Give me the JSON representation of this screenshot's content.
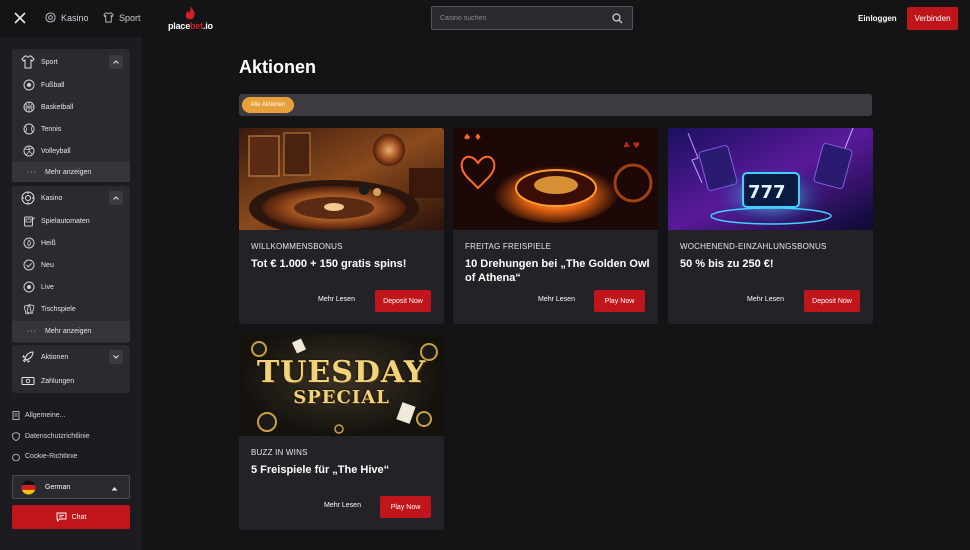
{
  "topbar": {
    "casino_label": "Kasino",
    "sport_label": "Sport",
    "logo_text_a": "place",
    "logo_text_b": "bet",
    "logo_text_c": ".io",
    "search_placeholder": "Casino suchen",
    "login_label": "Einloggen",
    "register_label": "Verbinden"
  },
  "sidebar": {
    "sport_head": "Sport",
    "sport_items": [
      "Fußball",
      "Basketball",
      "Tennis",
      "Volleyball"
    ],
    "sport_more": "Mehr anzeigen",
    "casino_head": "Kasino",
    "casino_items": [
      "Spielautomaten",
      "Heiß",
      "Neu",
      "Live",
      "Tischspiele"
    ],
    "casino_more": "Mehr anzeigen",
    "actions_label": "Aktionen",
    "payments_label": "Zahlungen",
    "links": [
      "Allgemeine...",
      "Datenschutzrichtlinie",
      "Cookie-Richtlinie"
    ],
    "language": "German",
    "chat": "Chat"
  },
  "main": {
    "title": "Aktionen",
    "filter_all": "Alle Aktionen"
  },
  "promos": [
    {
      "category": "WILLKOMMENSBONUS",
      "title": "Tot € 1.000 + 150 gratis spins!",
      "more": "Mehr Lesen",
      "cta": "Deposit Now"
    },
    {
      "category": "FREITAG FREISPIELE",
      "title": "10 Drehungen bei „The Golden Owl of Athena“",
      "more": "Mehr Lesen",
      "cta": "Play Now"
    },
    {
      "category": "WOCHENEND-EINZAHLUNGSBONUS",
      "title": "50 % bis zu 250 €!",
      "more": "Mehr Lesen",
      "cta": "Deposit Now"
    },
    {
      "category": "BUZZ IN WINS",
      "title": "5 Freispiele für „The Hive“",
      "more": "Mehr Lesen",
      "cta": "Play Now",
      "banner_line1": "TUESDAY",
      "banner_line2": "SPECIAL"
    }
  ],
  "colors": {
    "accent": "#c1151c",
    "pill": "#e8a13a",
    "bg": "#141416",
    "card": "#232327"
  }
}
